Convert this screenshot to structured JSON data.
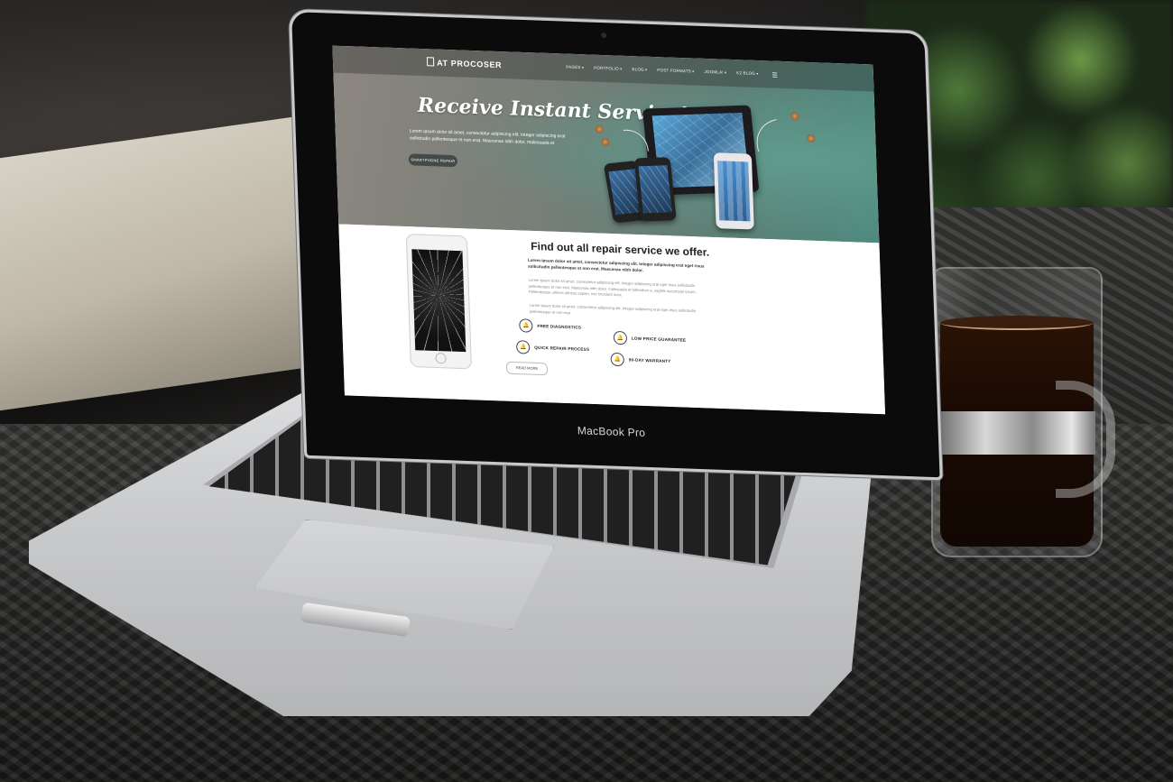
{
  "laptop": {
    "brand_label": "MacBook Pro"
  },
  "site": {
    "logo": "AT PROCOSER",
    "nav_items": [
      "PAGES",
      "PORTFOLIO",
      "BLOG",
      "POST FORMATS",
      "JOOMLA!",
      "K2 BLOG"
    ],
    "hero": {
      "title": "Receive Instant Service!",
      "text": "Lorem ipsum dolor sit amet, consectetur adipiscing elit. Integer adipiscing erat sollicitudin pellentesque et non erat. Maecenas nibh dolor, malesuada et",
      "button": "SMARTPHONE REPAIR"
    },
    "section": {
      "title": "Find out all repair service we offer.",
      "lead": "Lorem ipsum dolor sit amet, consectetur adipiscing elit. Integer adipiscing erat eget risus sollicitudin pellentesque et non erat. Maecenas nibh dolor.",
      "para1": "Lorem ipsum dolor sit amet, consectetur adipiscing elit. Integer adipiscing erat eget risus sollicitudin pellentesque et non erat. Maecenas nibh dolor, malesuada et bibendum a, sagittis accumsan ipsum. Pellentesque ultrices ultrices sapien, nec tincidunt nunc.",
      "para2": "Lorem ipsum dolor sit amet, consectetur adipiscing elit. Integer adipiscing erat eget risus sollicitudin pellentesque et non erat.",
      "features": [
        "FREE DIAGNOSTICS",
        "LOW PRICE GUARANTEE",
        "QUICK REPAIR PROCESS",
        "90-DAY WARRANTY"
      ],
      "read_more": "READ MORE"
    }
  }
}
